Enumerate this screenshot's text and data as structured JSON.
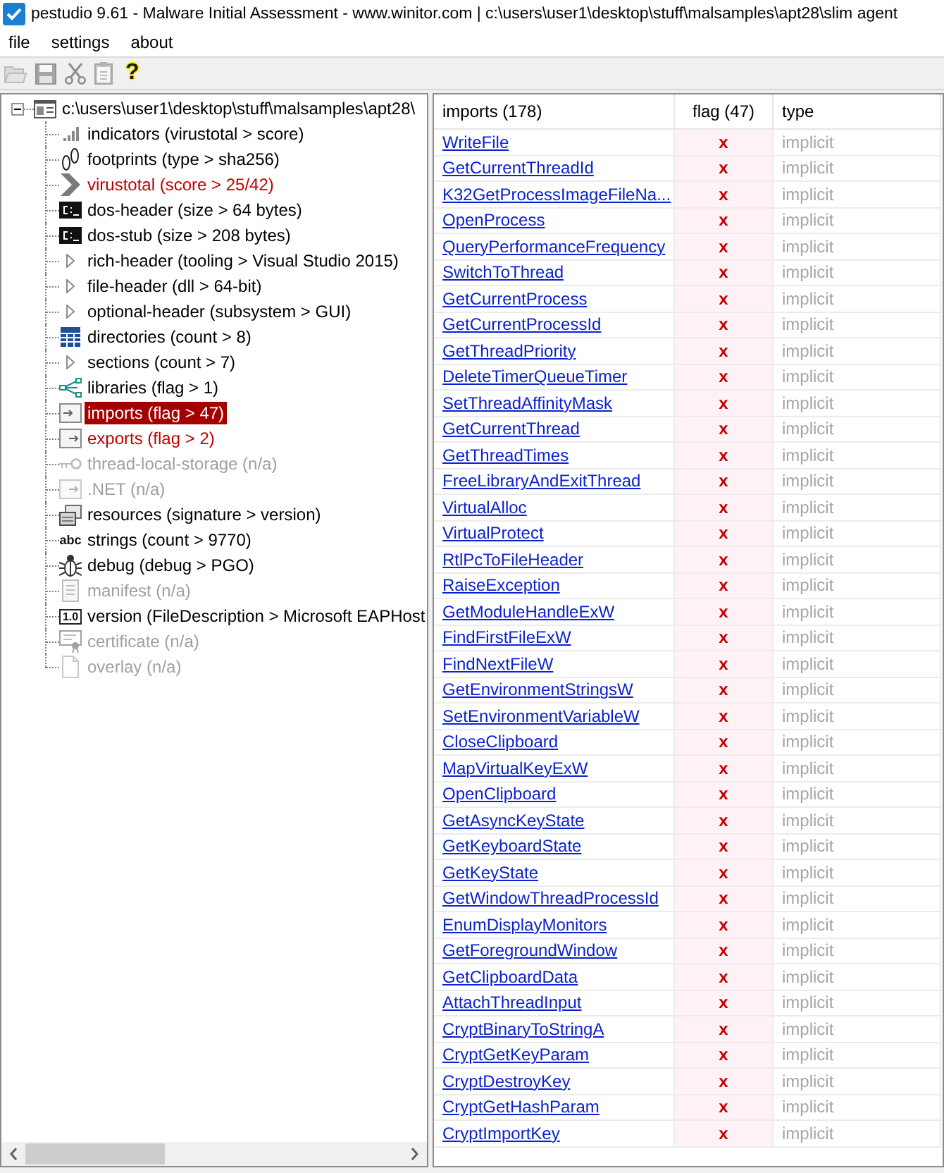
{
  "title_bar": {
    "title": "pestudio 9.61 - Malware Initial Assessment - www.winitor.com | c:\\users\\user1\\desktop\\stuff\\malsamples\\apt28\\slim agent"
  },
  "menu": [
    {
      "label": "file"
    },
    {
      "label": "settings"
    },
    {
      "label": "about"
    }
  ],
  "toolbar": [
    {
      "kind": "open",
      "disabled": true
    },
    {
      "kind": "save",
      "disabled": true
    },
    {
      "kind": "cut",
      "disabled": true
    },
    {
      "kind": "clipboard",
      "disabled": true
    },
    {
      "kind": "help",
      "label": "?",
      "disabled": false
    }
  ],
  "tree": {
    "label": "c:\\users\\user1\\desktop\\stuff\\malsamples\\apt28\\",
    "expanded": true,
    "children": [
      {
        "kind": "chart",
        "label": "indicators (virustotal > score)",
        "flagged": false,
        "disabled": false,
        "selected": false
      },
      {
        "kind": "footprints",
        "label": "footprints (type > sha256)",
        "flagged": false,
        "disabled": false,
        "selected": false
      },
      {
        "kind": "chevron",
        "label": "virustotal (score > 25/42)",
        "flagged": true,
        "disabled": false,
        "selected": false
      },
      {
        "kind": "console",
        "label": "dos-header (size > 64 bytes)",
        "flagged": false,
        "disabled": false,
        "selected": false
      },
      {
        "kind": "console",
        "label": "dos-stub (size > 208 bytes)",
        "flagged": false,
        "disabled": false,
        "selected": false
      },
      {
        "kind": "triangle",
        "label": "rich-header (tooling > Visual Studio 2015)",
        "flagged": false,
        "disabled": false,
        "selected": false
      },
      {
        "kind": "triangle",
        "label": "file-header (dll > 64-bit)",
        "flagged": false,
        "disabled": false,
        "selected": false
      },
      {
        "kind": "triangle",
        "label": "optional-header (subsystem > GUI)",
        "flagged": false,
        "disabled": false,
        "selected": false
      },
      {
        "kind": "grid",
        "label": "directories (count > 8)",
        "flagged": false,
        "disabled": false,
        "selected": false
      },
      {
        "kind": "triangle",
        "label": "sections (count > 7)",
        "flagged": false,
        "disabled": false,
        "selected": false
      },
      {
        "kind": "network",
        "label": "libraries (flag > 1)",
        "flagged": false,
        "disabled": false,
        "selected": false
      },
      {
        "kind": "import",
        "label": "imports (flag > 47)",
        "flagged": true,
        "disabled": false,
        "selected": true
      },
      {
        "kind": "export",
        "label": "exports (flag > 2)",
        "flagged": true,
        "disabled": false,
        "selected": false
      },
      {
        "kind": "key",
        "label": "thread-local-storage (n/a)",
        "flagged": false,
        "disabled": true,
        "selected": false
      },
      {
        "kind": "export",
        "label": ".NET (n/a)",
        "flagged": false,
        "disabled": true,
        "selected": false
      },
      {
        "kind": "resources",
        "label": "resources (signature > version)",
        "flagged": false,
        "disabled": false,
        "selected": false
      },
      {
        "kind": "text",
        "icon_text": "abc",
        "label": "strings (count > 9770)",
        "flagged": false,
        "disabled": false,
        "selected": false
      },
      {
        "kind": "bug",
        "label": "debug (debug > PGO)",
        "flagged": false,
        "disabled": false,
        "selected": false
      },
      {
        "kind": "document",
        "label": "manifest (n/a)",
        "flagged": false,
        "disabled": true,
        "selected": false
      },
      {
        "kind": "badge",
        "icon_text": "1.0",
        "label": "version (FileDescription > Microsoft EAPHost",
        "flagged": false,
        "disabled": false,
        "selected": false
      },
      {
        "kind": "certificate",
        "label": "certificate (n/a)",
        "flagged": false,
        "disabled": true,
        "selected": false
      },
      {
        "kind": "page",
        "label": "overlay (n/a)",
        "flagged": false,
        "disabled": true,
        "selected": false
      }
    ]
  },
  "table": {
    "columns": [
      {
        "label": "imports (178)"
      },
      {
        "label": "flag (47)"
      },
      {
        "label": "type"
      }
    ],
    "rows": [
      {
        "name": "WriteFile",
        "flag": "x",
        "type": "implicit"
      },
      {
        "name": "GetCurrentThreadId",
        "flag": "x",
        "type": "implicit"
      },
      {
        "name": "K32GetProcessImageFileNa...",
        "flag": "x",
        "type": "implicit"
      },
      {
        "name": "OpenProcess",
        "flag": "x",
        "type": "implicit"
      },
      {
        "name": "QueryPerformanceFrequency",
        "flag": "x",
        "type": "implicit"
      },
      {
        "name": "SwitchToThread",
        "flag": "x",
        "type": "implicit"
      },
      {
        "name": "GetCurrentProcess",
        "flag": "x",
        "type": "implicit"
      },
      {
        "name": "GetCurrentProcessId",
        "flag": "x",
        "type": "implicit"
      },
      {
        "name": "GetThreadPriority",
        "flag": "x",
        "type": "implicit"
      },
      {
        "name": "DeleteTimerQueueTimer",
        "flag": "x",
        "type": "implicit"
      },
      {
        "name": "SetThreadAffinityMask",
        "flag": "x",
        "type": "implicit"
      },
      {
        "name": "GetCurrentThread",
        "flag": "x",
        "type": "implicit"
      },
      {
        "name": "GetThreadTimes",
        "flag": "x",
        "type": "implicit"
      },
      {
        "name": "FreeLibraryAndExitThread",
        "flag": "x",
        "type": "implicit"
      },
      {
        "name": "VirtualAlloc",
        "flag": "x",
        "type": "implicit"
      },
      {
        "name": "VirtualProtect",
        "flag": "x",
        "type": "implicit"
      },
      {
        "name": "RtlPcToFileHeader",
        "flag": "x",
        "type": "implicit"
      },
      {
        "name": "RaiseException",
        "flag": "x",
        "type": "implicit"
      },
      {
        "name": "GetModuleHandleExW",
        "flag": "x",
        "type": "implicit"
      },
      {
        "name": "FindFirstFileExW",
        "flag": "x",
        "type": "implicit"
      },
      {
        "name": "FindNextFileW",
        "flag": "x",
        "type": "implicit"
      },
      {
        "name": "GetEnvironmentStringsW",
        "flag": "x",
        "type": "implicit"
      },
      {
        "name": "SetEnvironmentVariableW",
        "flag": "x",
        "type": "implicit"
      },
      {
        "name": "CloseClipboard",
        "flag": "x",
        "type": "implicit"
      },
      {
        "name": "MapVirtualKeyExW",
        "flag": "x",
        "type": "implicit"
      },
      {
        "name": "OpenClipboard",
        "flag": "x",
        "type": "implicit"
      },
      {
        "name": "GetAsyncKeyState",
        "flag": "x",
        "type": "implicit"
      },
      {
        "name": "GetKeyboardState",
        "flag": "x",
        "type": "implicit"
      },
      {
        "name": "GetKeyState",
        "flag": "x",
        "type": "implicit"
      },
      {
        "name": "GetWindowThreadProcessId",
        "flag": "x",
        "type": "implicit"
      },
      {
        "name": "EnumDisplayMonitors",
        "flag": "x",
        "type": "implicit"
      },
      {
        "name": "GetForegroundWindow",
        "flag": "x",
        "type": "implicit"
      },
      {
        "name": "GetClipboardData",
        "flag": "x",
        "type": "implicit"
      },
      {
        "name": "AttachThreadInput",
        "flag": "x",
        "type": "implicit"
      },
      {
        "name": "CryptBinaryToStringA",
        "flag": "x",
        "type": "implicit"
      },
      {
        "name": "CryptGetKeyParam",
        "flag": "x",
        "type": "implicit"
      },
      {
        "name": "CryptDestroyKey",
        "flag": "x",
        "type": "implicit"
      },
      {
        "name": "CryptGetHashParam",
        "flag": "x",
        "type": "implicit"
      },
      {
        "name": "CryptImportKey",
        "flag": "x",
        "type": "implicit"
      }
    ]
  }
}
